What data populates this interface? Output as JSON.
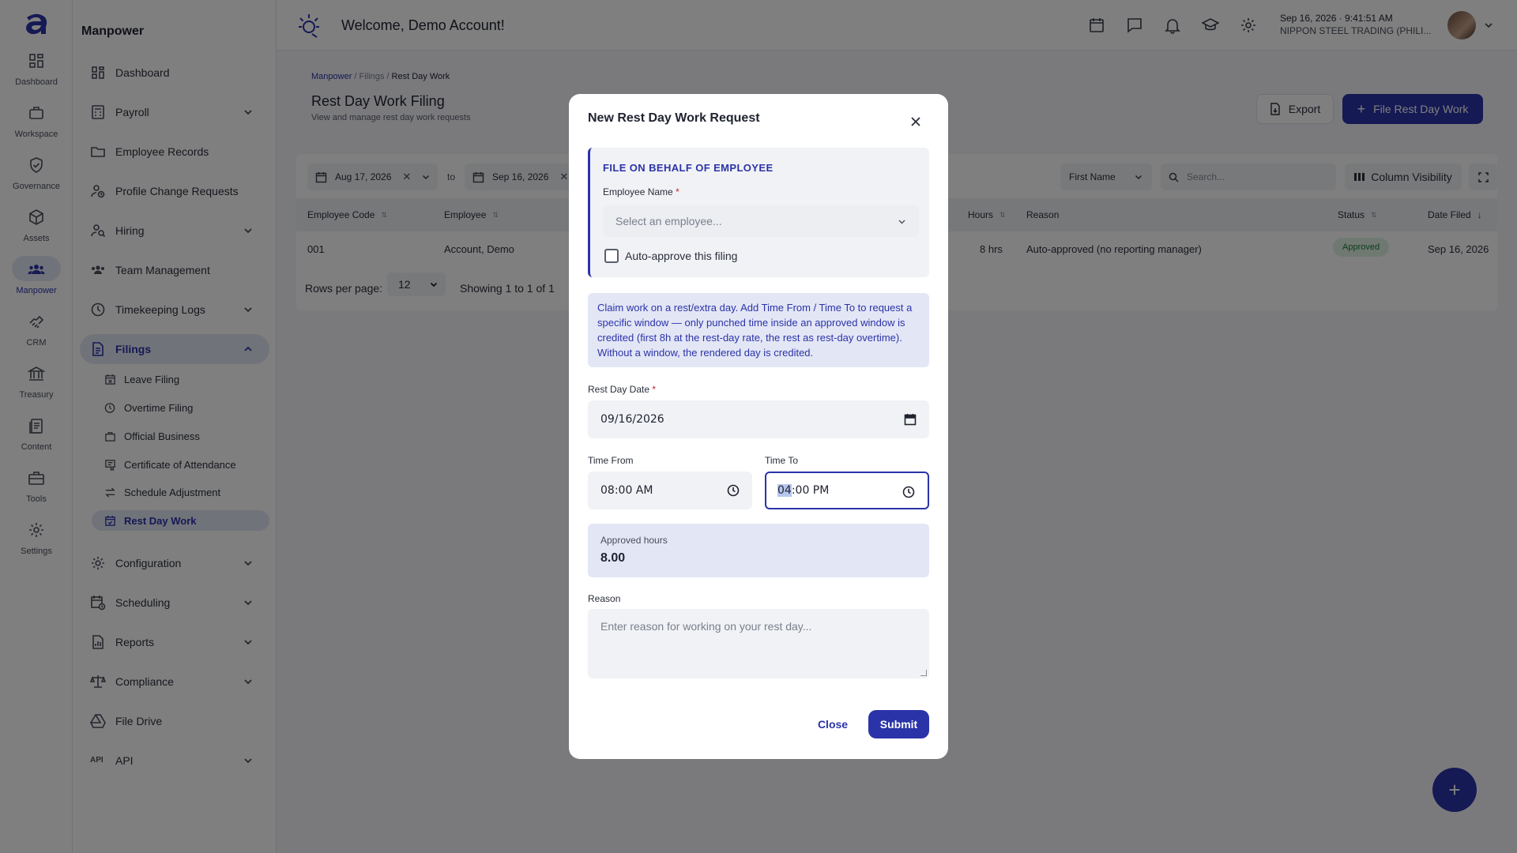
{
  "rail": {
    "items": [
      {
        "label": "Dashboard",
        "icon": "grid-icon"
      },
      {
        "label": "Workspace",
        "icon": "briefcase-icon"
      },
      {
        "label": "Governance",
        "icon": "shield-check-icon"
      },
      {
        "label": "Assets",
        "icon": "cube-icon"
      },
      {
        "label": "Manpower",
        "icon": "people-icon"
      },
      {
        "label": "CRM",
        "icon": "handshake-icon"
      },
      {
        "label": "Treasury",
        "icon": "bank-icon"
      },
      {
        "label": "Content",
        "icon": "document-icon"
      },
      {
        "label": "Tools",
        "icon": "toolbox-icon"
      },
      {
        "label": "Settings",
        "icon": "gear-icon"
      }
    ],
    "active": "Manpower"
  },
  "nav": {
    "title": "Manpower",
    "items": [
      {
        "label": "Dashboard"
      },
      {
        "label": "Payroll"
      },
      {
        "label": "Employee Records"
      },
      {
        "label": "Profile Change Requests"
      },
      {
        "label": "Hiring"
      },
      {
        "label": "Team Management"
      },
      {
        "label": "Timekeeping Logs"
      },
      {
        "label": "Filings"
      },
      {
        "label": "Configuration"
      },
      {
        "label": "Scheduling"
      },
      {
        "label": "Reports"
      },
      {
        "label": "Compliance"
      },
      {
        "label": "File Drive"
      },
      {
        "label": "API"
      }
    ],
    "filings_sub": [
      {
        "label": "Leave Filing"
      },
      {
        "label": "Overtime Filing"
      },
      {
        "label": "Official Business"
      },
      {
        "label": "Certificate of Attendance"
      },
      {
        "label": "Schedule Adjustment"
      },
      {
        "label": "Rest Day Work"
      }
    ],
    "api_icon_text": "API"
  },
  "topbar": {
    "welcome": "Welcome, Demo Account!",
    "datetime": "Sep 16, 2026 · 9:41:51 AM",
    "company": "NIPPON STEEL TRADING (PHILI..."
  },
  "page": {
    "breadcrumb": [
      "Manpower",
      "Filings",
      "Rest Day Work"
    ],
    "title": "Rest Day Work Filing",
    "subtitle": "View and manage rest day work requests",
    "export_label": "Export",
    "file_label": "File Rest Day Work"
  },
  "filters": {
    "date_from": "Aug 17, 2026",
    "to_label": "to",
    "date_to": "Sep 16, 2026",
    "sort_field": "First Name",
    "search_placeholder": "Search...",
    "column_visibility": "Column Visibility"
  },
  "table": {
    "headers": [
      "Employee Code",
      "Employee",
      "Hours",
      "Reason",
      "Status",
      "Date Filed"
    ],
    "rows": [
      {
        "code": "001",
        "employee": "Account, Demo",
        "hours": "8 hrs",
        "reason": "Auto-approved (no reporting manager)",
        "status": "Approved",
        "date_filed": "Sep 16, 2026"
      }
    ],
    "rows_per_page_label": "Rows per page:",
    "rows_per_page": "12",
    "showing": "Showing 1 to 1 of 1"
  },
  "modal": {
    "title": "New Rest Day Work Request",
    "behalf_heading": "FILE ON BEHALF OF EMPLOYEE",
    "employee_label": "Employee Name",
    "required_mark": "*",
    "employee_placeholder": "Select an employee...",
    "auto_approve_label": "Auto-approve this filing",
    "info": "Claim work on a rest/extra day. Add Time From / Time To to request a specific window — only punched time inside an approved window is credited (first 8h at the rest-day rate, the rest as rest-day overtime). Without a window, the rendered day is credited.",
    "rest_day_label": "Rest Day Date",
    "rest_day_value": "09/16/2026",
    "time_from_label": "Time From",
    "time_from_value": "08:00 AM",
    "time_to_label": "Time To",
    "time_to_hour": "04",
    "time_to_rest": ":00 PM",
    "approved_label": "Approved hours",
    "approved_value": "8.00",
    "reason_label": "Reason",
    "reason_placeholder": "Enter reason for working on your rest day...",
    "close_label": "Close",
    "submit_label": "Submit"
  },
  "colors": {
    "accent": "#2b33a8",
    "approved_badge_bg": "#dff3e3",
    "approved_badge_text": "#1f7a38",
    "overlay": "rgba(0,0,0,0.5)"
  }
}
